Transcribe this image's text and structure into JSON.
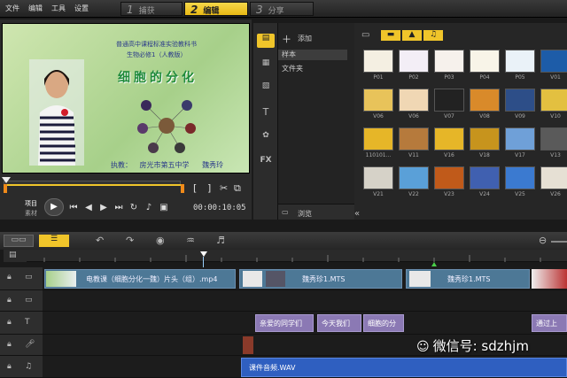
{
  "menu": {
    "file": "文件",
    "edit": "编辑",
    "tools": "工具",
    "settings": "设置"
  },
  "steps": [
    {
      "num": "1",
      "label": "捕获"
    },
    {
      "num": "2",
      "label": "编辑"
    },
    {
      "num": "3",
      "label": "分享"
    }
  ],
  "preview": {
    "title1": "普通高中课程标准实验教科书",
    "title2": "生物必修1（人教版）",
    "big_title": "细胞的分化",
    "credit_label": "执教：",
    "credit_school": "房光市第五中学",
    "credit_name": "魏秀玲",
    "project_label": "项目",
    "clip_label": "素材",
    "timecode": "00:00:10:05"
  },
  "library": {
    "add_label": "添加",
    "tree": [
      {
        "label": "样本"
      },
      {
        "label": "文件夹"
      }
    ],
    "browse_label": "浏览",
    "thumbs": [
      {
        "label": "P01",
        "color": "#f4efe2"
      },
      {
        "label": "P02",
        "color": "#f3eef6"
      },
      {
        "label": "P03",
        "color": "#f6f1ec"
      },
      {
        "label": "P04",
        "color": "#f8f4e8"
      },
      {
        "label": "P05",
        "color": "#eaf2f8"
      },
      {
        "label": "V01",
        "color": "#1d5ca8"
      },
      {
        "label": "V06",
        "color": "#e8c35a"
      },
      {
        "label": "V06",
        "color": "#f0d7b4"
      },
      {
        "label": "V07",
        "color": "#222"
      },
      {
        "label": "V08",
        "color": "#d98a2a"
      },
      {
        "label": "V09",
        "color": "#2d4e88"
      },
      {
        "label": "V10",
        "color": "#e3c040"
      },
      {
        "label": "110101...",
        "color": "#e6b628"
      },
      {
        "label": "V11",
        "color": "#b67a3c"
      },
      {
        "label": "V16",
        "color": "#e6b628"
      },
      {
        "label": "V18",
        "color": "#c7941d"
      },
      {
        "label": "V17",
        "color": "#6fa0d8"
      },
      {
        "label": "V13",
        "color": "#5a5a5a"
      },
      {
        "label": "V21",
        "color": "#d6d2c8"
      },
      {
        "label": "V22",
        "color": "#5aa0d8"
      },
      {
        "label": "V23",
        "color": "#c05a1a"
      },
      {
        "label": "V24",
        "color": "#4060b0"
      },
      {
        "label": "V25",
        "color": "#3b7ad0"
      },
      {
        "label": "V26",
        "color": "#e6e0d4"
      }
    ]
  },
  "timeline": {
    "video_clips": [
      {
        "label": "电教课（细胞分化一魏）片头（组）.mp4"
      },
      {
        "label": "魏秀珍1.MTS"
      },
      {
        "label": "魏秀珍1.MTS"
      }
    ],
    "title_clips": [
      {
        "label": "亲爱的同学们"
      },
      {
        "label": "今天我们"
      },
      {
        "label": "细胞的分"
      },
      {
        "label": "通过上"
      }
    ],
    "music_clip": "课件音频.WAV",
    "watermark": "微信号: sdzhjm"
  },
  "colors": {
    "accent": "#f0c52a",
    "video_clip": "#4d7896",
    "title_clip": "#8b79b4",
    "music_clip": "#2f5fc0"
  }
}
